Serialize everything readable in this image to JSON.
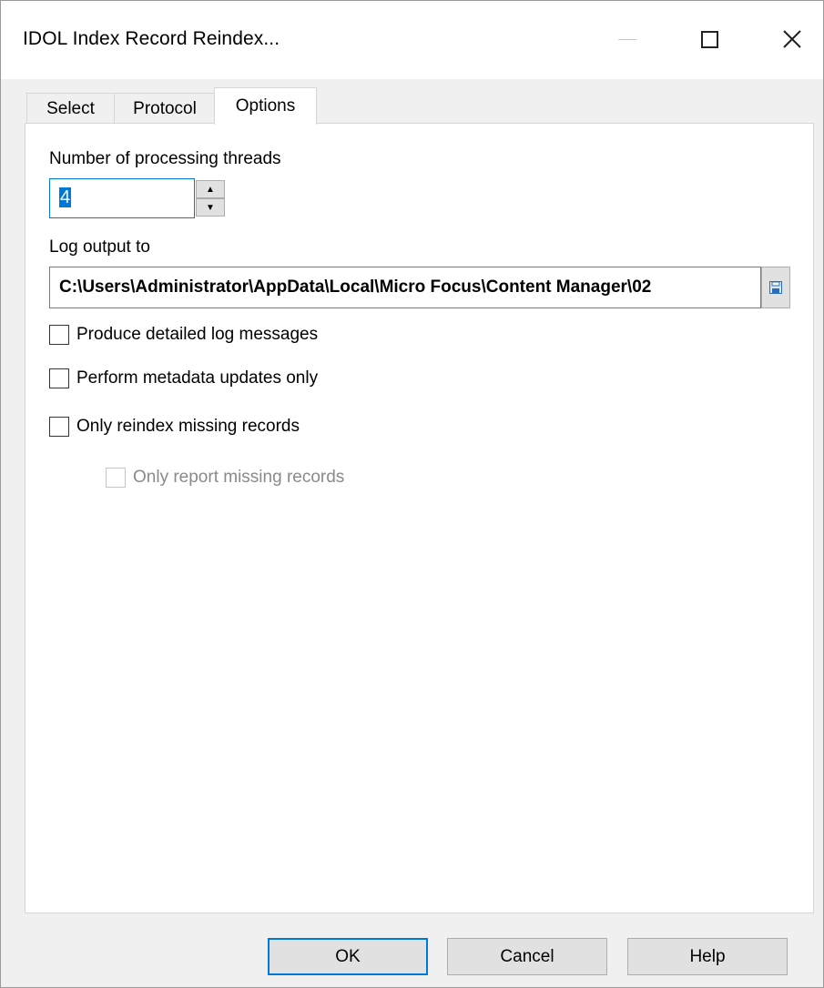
{
  "window": {
    "title": "IDOL Index Record Reindex..."
  },
  "tabs": [
    {
      "label": "Select",
      "active": false
    },
    {
      "label": "Protocol",
      "active": false
    },
    {
      "label": "Options",
      "active": true
    }
  ],
  "options": {
    "threads_label": "Number of processing threads",
    "threads_value": "4",
    "log_label": "Log output to",
    "log_path": "C:\\Users\\Administrator\\AppData\\Local\\Micro Focus\\Content Manager\\02",
    "checkboxes": [
      {
        "label": "Produce detailed log messages",
        "checked": false,
        "enabled": true
      },
      {
        "label": "Perform metadata updates only",
        "checked": false,
        "enabled": true
      },
      {
        "label": "Only reindex missing records",
        "checked": false,
        "enabled": true
      },
      {
        "label": "Only report missing records",
        "checked": false,
        "enabled": false
      }
    ]
  },
  "buttons": {
    "ok": "OK",
    "cancel": "Cancel",
    "help": "Help"
  },
  "colors": {
    "accent": "#0078d7",
    "disabled_text": "#8a8a8a"
  }
}
